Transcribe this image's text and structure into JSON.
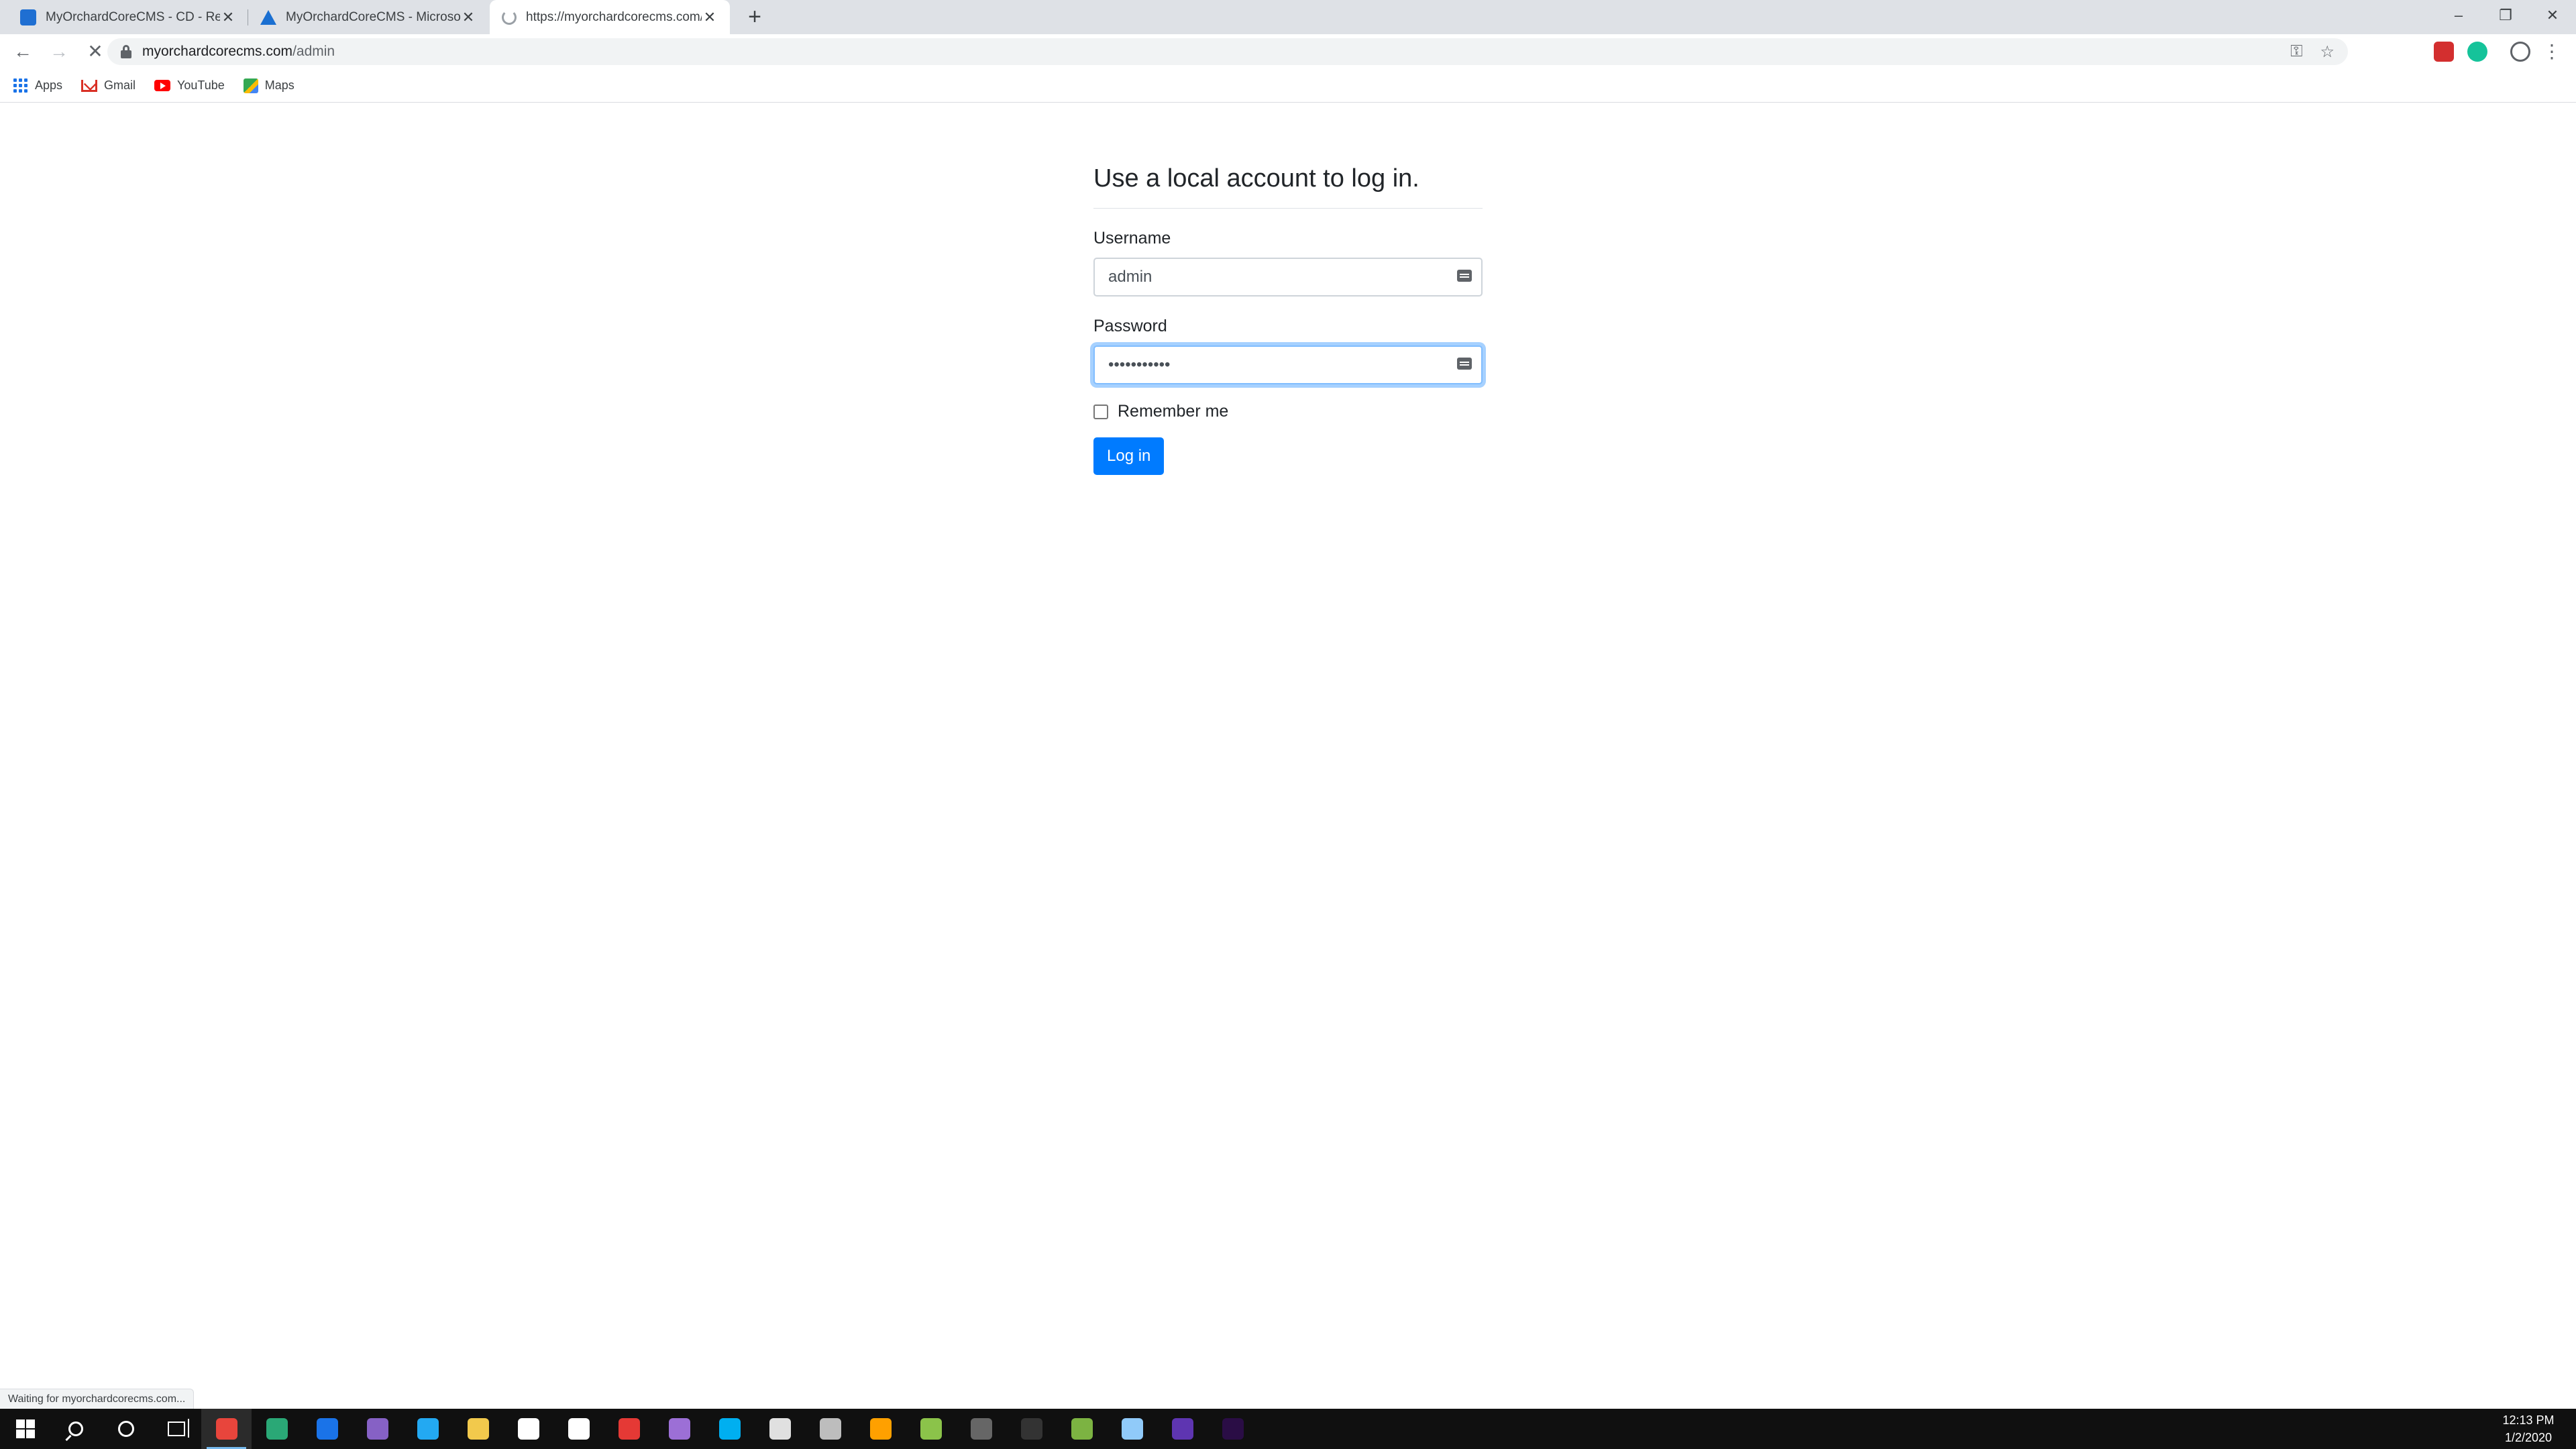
{
  "tabs": [
    {
      "title": "MyOrchardCoreCMS - CD - Rele",
      "favicon": "azure-devops-icon",
      "active": false
    },
    {
      "title": "MyOrchardCoreCMS - Microsoft",
      "favicon": "azure-icon",
      "active": false
    },
    {
      "title": "https://myorchardcorecms.com/a",
      "favicon": "loading-spinner-icon",
      "active": true
    }
  ],
  "new_tab_label": "+",
  "window_controls": {
    "minimize": "–",
    "restore": "❐",
    "close": "✕"
  },
  "toolbar": {
    "back": "←",
    "forward": "→",
    "stop": "✕",
    "url_host": "myorchardcorecms.com",
    "url_path": "/admin",
    "key": "⚿",
    "star": "☆",
    "menu": "⋮"
  },
  "bookmarks": [
    {
      "label": "Apps",
      "icon": "apps-grid-icon"
    },
    {
      "label": "Gmail",
      "icon": "gmail-icon"
    },
    {
      "label": "YouTube",
      "icon": "youtube-icon"
    },
    {
      "label": "Maps",
      "icon": "maps-icon"
    }
  ],
  "login": {
    "heading": "Use a local account to log in.",
    "username_label": "Username",
    "username_value": "admin",
    "password_label": "Password",
    "password_value": "•••••••••••",
    "remember_label": "Remember me",
    "remember_checked": false,
    "submit_label": "Log in"
  },
  "status_bar": "Waiting for myorchardcorecms.com...",
  "taskbar": {
    "apps": [
      {
        "name": "chrome",
        "color": "#e8453c",
        "active": true
      },
      {
        "name": "edge-dev",
        "color": "#2aa876"
      },
      {
        "name": "edge",
        "color": "#1a73e8"
      },
      {
        "name": "visual-studio",
        "color": "#8661c5"
      },
      {
        "name": "vscode",
        "color": "#23a9f2"
      },
      {
        "name": "file-explorer",
        "color": "#f2c94c"
      },
      {
        "name": "store",
        "color": "#ffffff"
      },
      {
        "name": "mail",
        "color": "#ffffff"
      },
      {
        "name": "app-red",
        "color": "#e53935"
      },
      {
        "name": "github",
        "color": "#9c6fd6"
      },
      {
        "name": "skype",
        "color": "#00aff0"
      },
      {
        "name": "slack",
        "color": "#e0e0e0"
      },
      {
        "name": "app-clock",
        "color": "#bdbdbd"
      },
      {
        "name": "app-orange",
        "color": "#ffa000"
      },
      {
        "name": "app-fruit",
        "color": "#8bc34a"
      },
      {
        "name": "app-dark",
        "color": "#666666"
      },
      {
        "name": "terminal",
        "color": "#333333"
      },
      {
        "name": "app-green",
        "color": "#7cb342"
      },
      {
        "name": "app-blue",
        "color": "#90caf9"
      },
      {
        "name": "app-purple",
        "color": "#5e35b1"
      },
      {
        "name": "premiere-pro",
        "color": "#2a0d45"
      }
    ],
    "time": "12:13 PM",
    "date": "1/2/2020"
  }
}
